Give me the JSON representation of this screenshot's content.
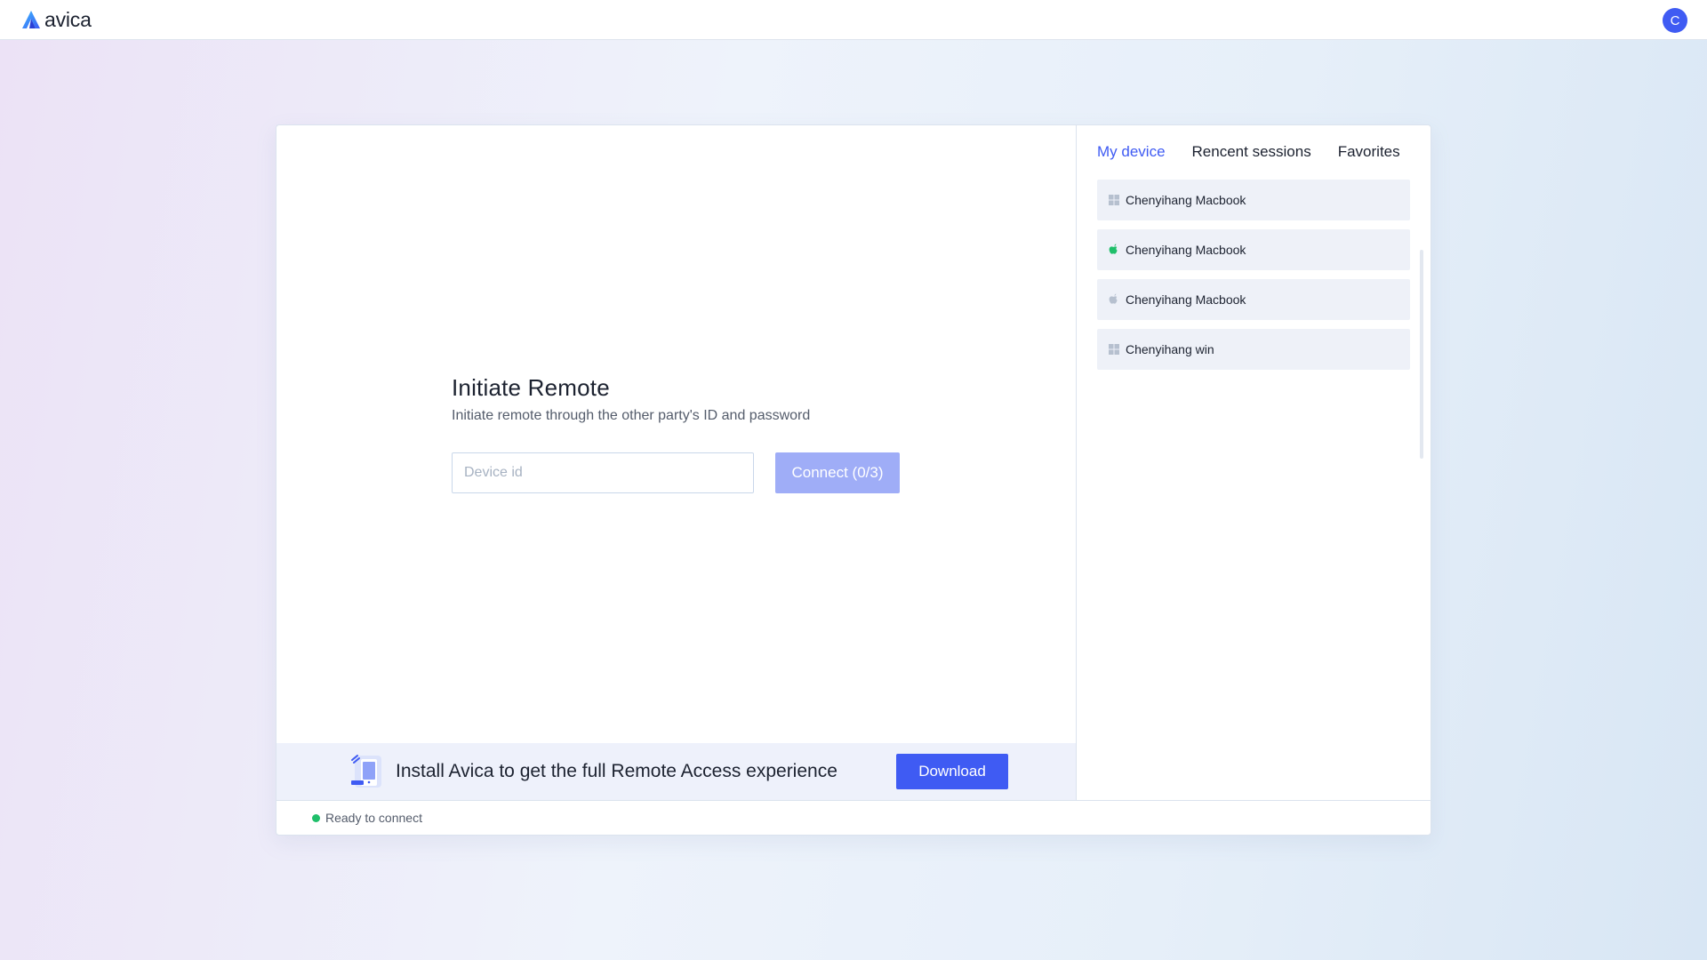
{
  "header": {
    "app_name": "avica",
    "avatar_initial": "C",
    "brand_color": "#3f5bf3"
  },
  "remote": {
    "title": "Initiate Remote",
    "subtitle": "Initiate remote through the other party's ID and password",
    "input_placeholder": "Device id",
    "input_value": "",
    "connect_label": "Connect (0/3)"
  },
  "banner": {
    "text": "Install Avica to get the full Remote Access experience",
    "download_label": "Download",
    "illustration_icon": "phone-device-icon"
  },
  "status": {
    "text": "Ready to connect",
    "color": "#1fbf6a"
  },
  "tabs": [
    {
      "label": "My device",
      "active": true
    },
    {
      "label": "Rencent sessions",
      "active": false
    },
    {
      "label": "Favorites",
      "active": false
    }
  ],
  "devices": [
    {
      "name": "Chenyihang Macbook",
      "icon": "windows-icon",
      "online": false
    },
    {
      "name": "Chenyihang Macbook",
      "icon": "apple-icon",
      "online": true
    },
    {
      "name": "Chenyihang Macbook",
      "icon": "apple-icon",
      "online": false
    },
    {
      "name": "Chenyihang win",
      "icon": "windows-icon",
      "online": false
    }
  ]
}
